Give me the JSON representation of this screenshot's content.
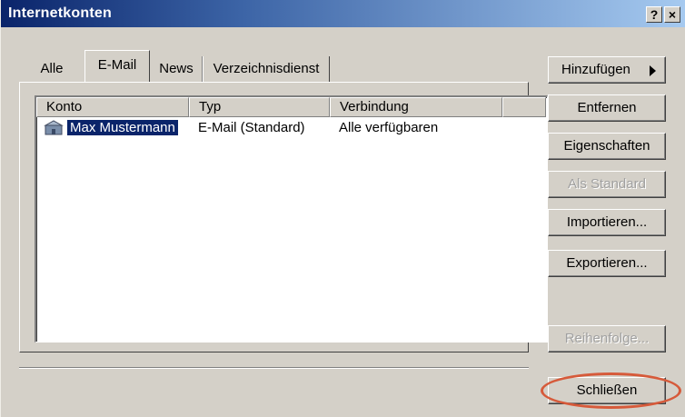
{
  "window": {
    "title": "Internetkonten",
    "help_label": "?",
    "close_label": "×"
  },
  "tabs": [
    {
      "label": "Alle",
      "active": false
    },
    {
      "label": "E-Mail",
      "active": true
    },
    {
      "label": "News",
      "active": false
    },
    {
      "label": "Verzeichnisdienst",
      "active": false
    }
  ],
  "accounts_list": {
    "columns": [
      "Konto",
      "Typ",
      "Verbindung"
    ],
    "rows": [
      {
        "konto": "Max Mustermann",
        "typ": "E-Mail (Standard)",
        "verbindung": "Alle verfügbaren",
        "selected": true
      }
    ]
  },
  "buttons": {
    "add": "Hinzufügen",
    "remove": "Entfernen",
    "properties": "Eigenschaften",
    "set_default": "Als Standard",
    "import": "Importieren...",
    "export": "Exportieren...",
    "order": "Reihenfolge...",
    "close": "Schließen"
  },
  "colors": {
    "selection": "#0a246a",
    "highlight_ring": "#d65a3a"
  }
}
